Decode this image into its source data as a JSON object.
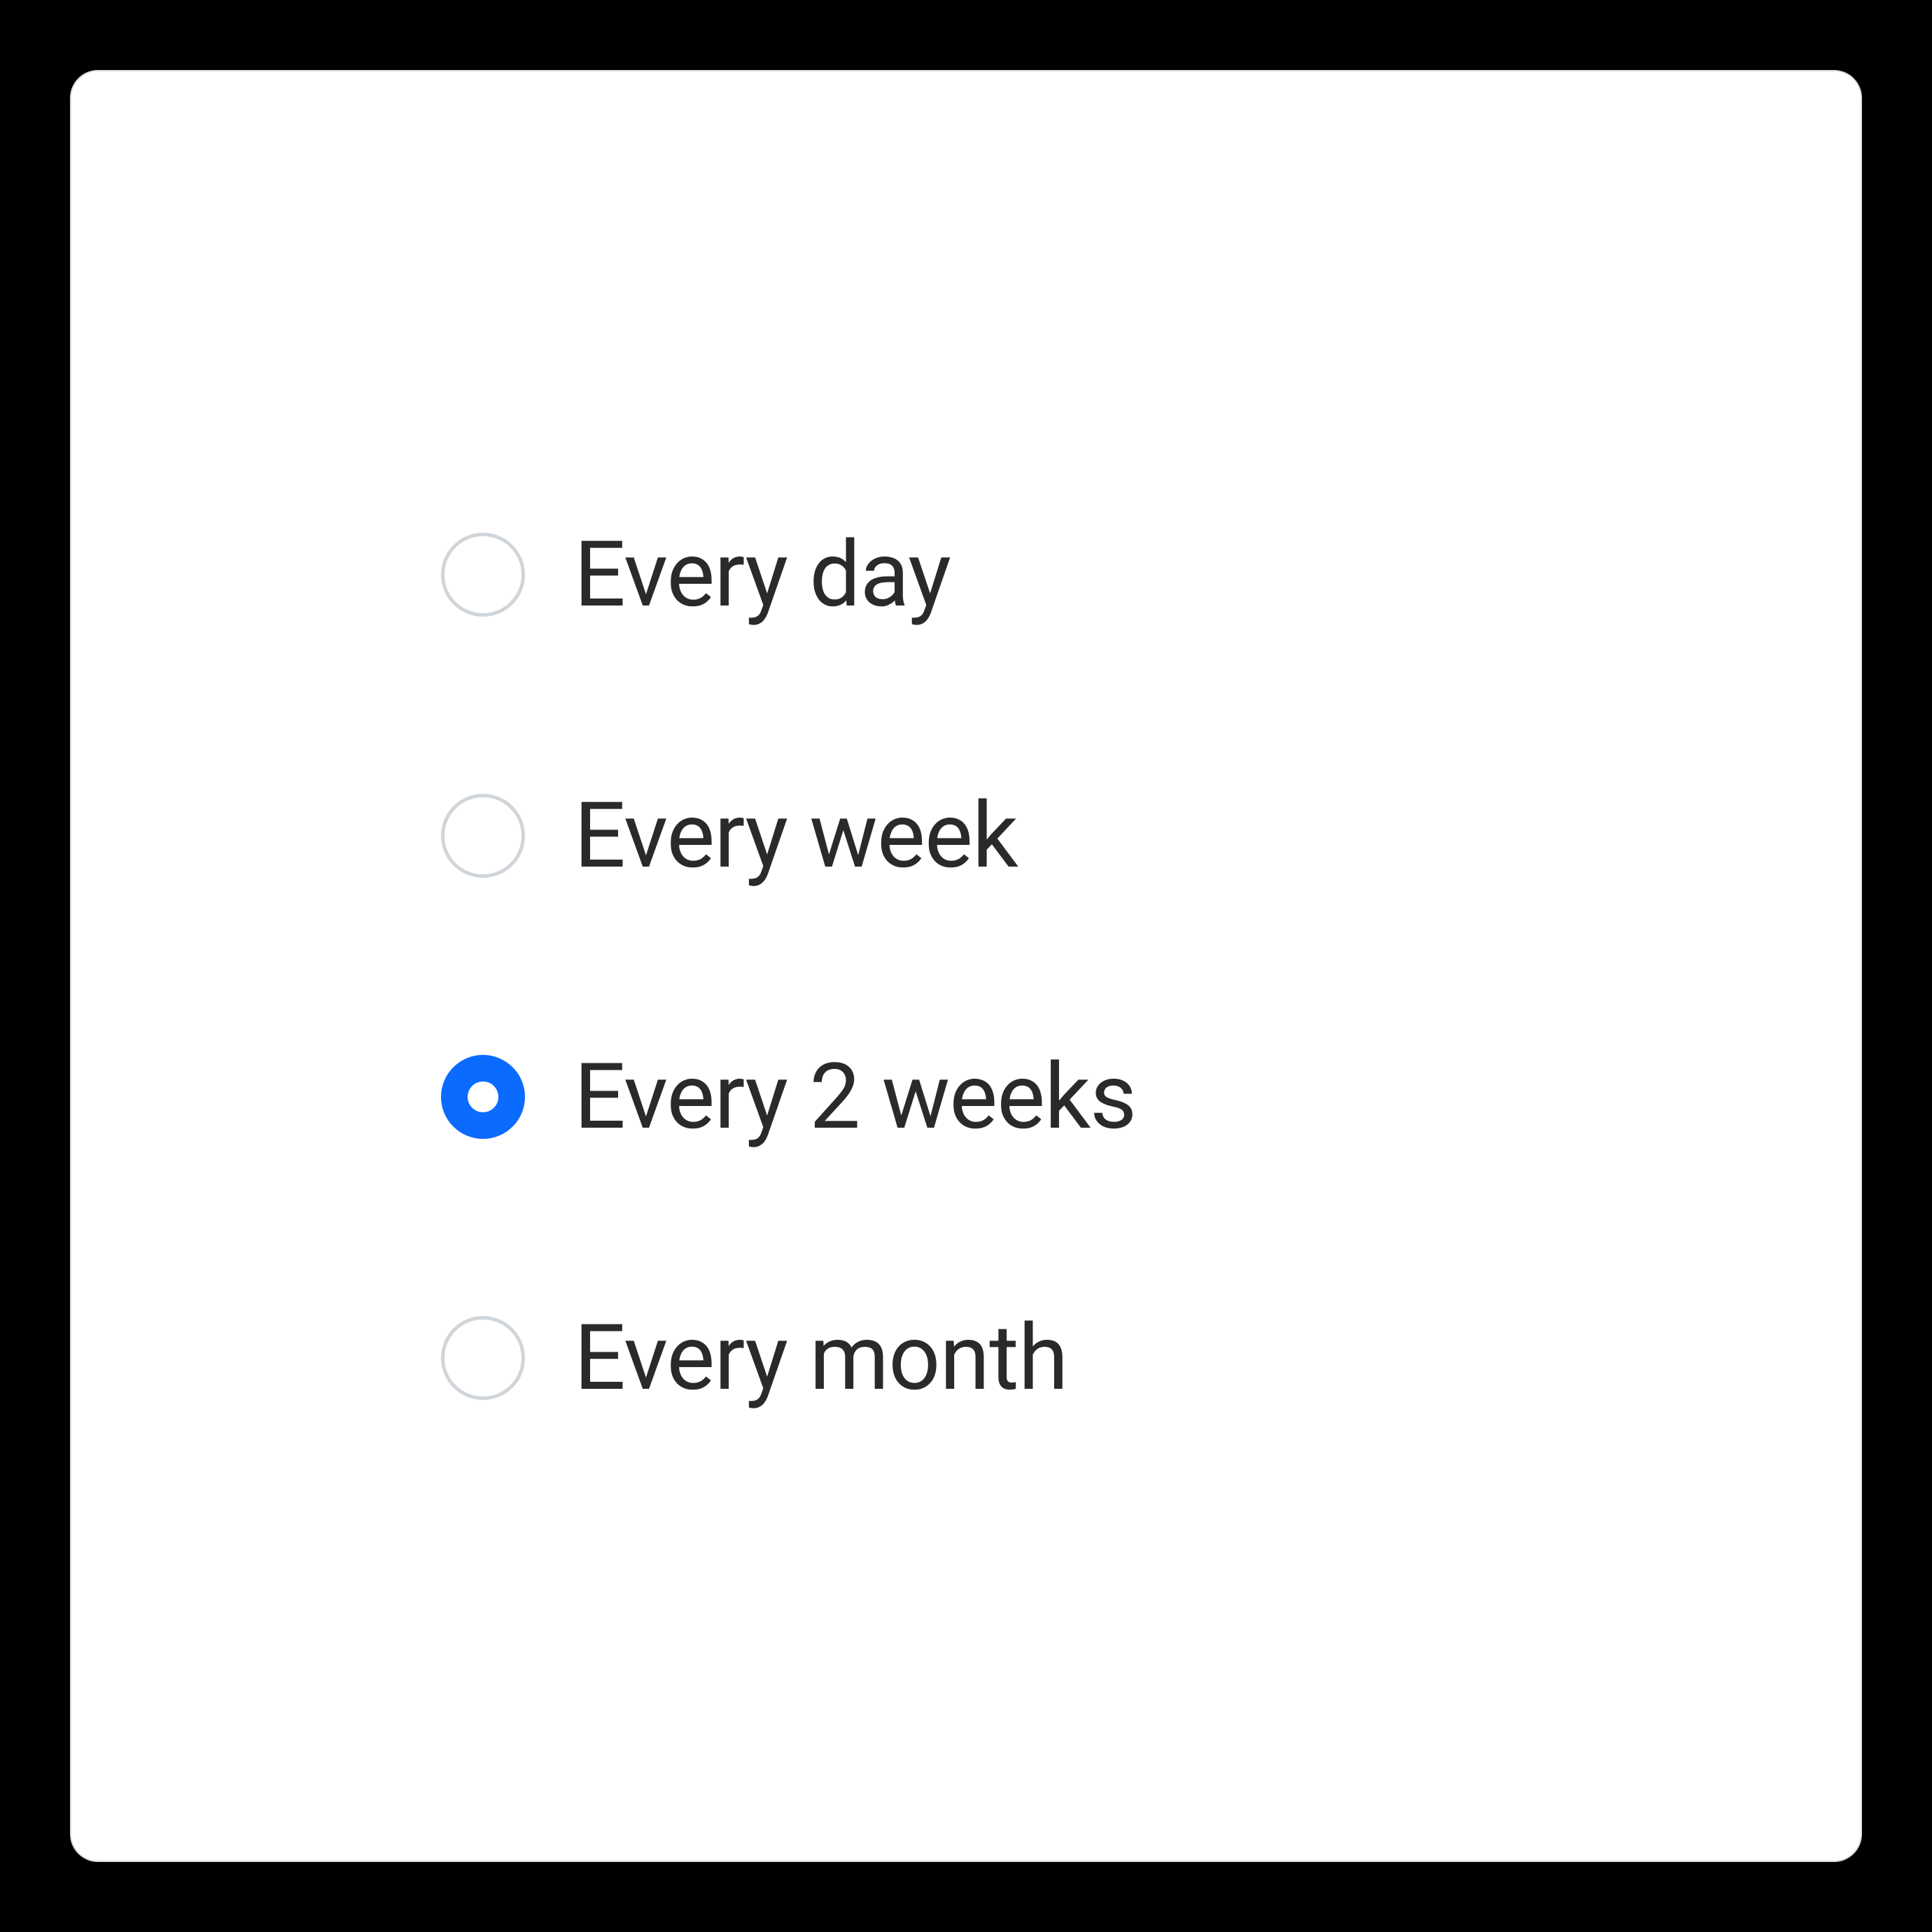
{
  "options": [
    {
      "label": "Every day",
      "selected": false
    },
    {
      "label": "Every week",
      "selected": false
    },
    {
      "label": "Every 2 weeks",
      "selected": true
    },
    {
      "label": "Every month",
      "selected": false
    }
  ],
  "colors": {
    "accent": "#0b6bff",
    "text": "#2a2a2a",
    "border": "#d0d5da"
  }
}
